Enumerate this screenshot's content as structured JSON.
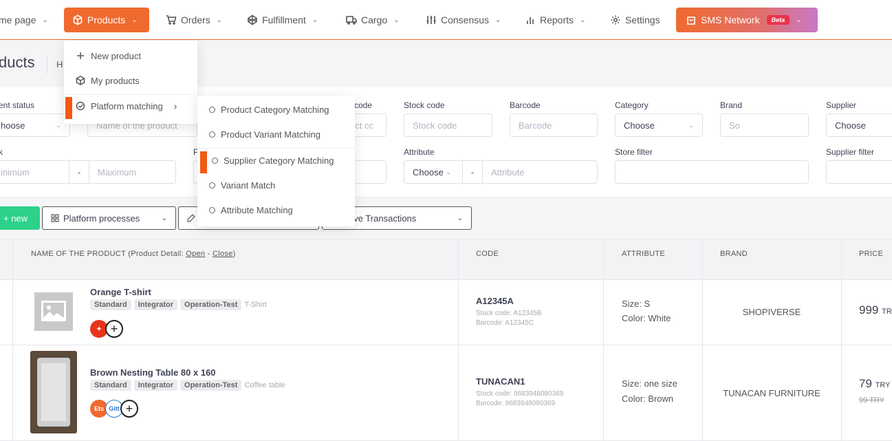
{
  "nav": {
    "home": "me page",
    "products": "Products",
    "orders": "Orders",
    "fulfillment": "Fulfillment",
    "cargo": "Cargo",
    "consensus": "Consensus",
    "reports": "Reports",
    "settings": "Settings",
    "sms": "SMS Network",
    "beta": "Beta"
  },
  "page": {
    "title": "ducts",
    "crumb": "H"
  },
  "products_menu": {
    "items": [
      "New product",
      "My products",
      "Platform matching"
    ]
  },
  "submenu": {
    "items": [
      "Product Category Matching",
      "Product Variant Matching",
      "Supplier Category Matching",
      "Variant Match",
      "Attribute Matching"
    ]
  },
  "filters": {
    "row1": {
      "status_label": "ent status",
      "status_value": "hoose",
      "name_placeholder": "Name of the product",
      "code_label": "code",
      "code_placeholder": "uct cc",
      "stock_label": "Stock code",
      "stock_placeholder": "Stock code",
      "barcode_label": "Barcode",
      "barcode_placeholder": "Barcode",
      "category_label": "Category",
      "category_value": "Choose",
      "brand_label": "Brand",
      "brand_placeholder": "So",
      "supplier_label": "Supplier",
      "supplier_value": "Choose"
    },
    "row2": {
      "stock_label": "k",
      "min_placeholder": "inimum",
      "dash": "-",
      "max_placeholder": "Maximum",
      "price_label": "P",
      "attribute_label": "Attribute",
      "attribute_choose": "Choose",
      "attribute_placeholder": "Attribute",
      "store_label": "Store filter",
      "supplier_filter_label": "Supplier filter"
    }
  },
  "actions": {
    "new": "+ new",
    "platform_processes": "Platform processes",
    "collective": "ollective Transactions"
  },
  "table": {
    "headers": {
      "name_prefix": "NAME OF THE PRODUCT (Product Detail: ",
      "open": "Open",
      "sep": " - ",
      "close": "Close",
      "suffix": ")",
      "code": "CODE",
      "attribute": "ATTRIBUTE",
      "brand": "BRAND",
      "price": "PRICE"
    },
    "rows": [
      {
        "name": "Orange T-shirt",
        "tags": [
          "Standard",
          "Integrator",
          "Operation-Test"
        ],
        "category": "T-Shirt",
        "code": "A12345A",
        "stock_code": "Stock code: A12345B",
        "barcode": "Barcode: A12345C",
        "attr1": "Size: S",
        "attr2": "Color: White",
        "brand": "SHOPIVERSE",
        "price": "999",
        "currency": "TRY"
      },
      {
        "name": "Brown Nesting Table 80 x 160",
        "tags": [
          "Standard",
          "Integrator",
          "Operation-Test"
        ],
        "category": "Coffee table",
        "code": "TUNACAN1",
        "stock_code": "Stock code: 8683948080369",
        "barcode": "Barcode: 8683948080369",
        "attr1": "Size: one size",
        "attr2": "Color: Brown",
        "brand": "TUNACAN FURNITURE",
        "price": "79",
        "currency": "TRY",
        "old_price": "99 TRY",
        "chan1": "Ets",
        "chan2": "Gitt"
      }
    ]
  },
  "colors": {
    "accent": "#f06a2f",
    "green": "#2dd18a",
    "marker": "#f25a12"
  }
}
